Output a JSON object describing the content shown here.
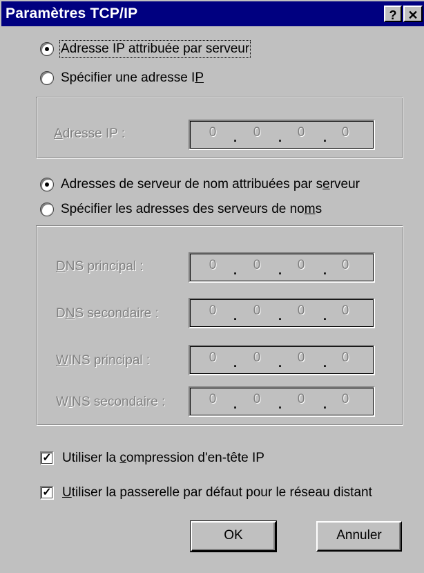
{
  "window": {
    "title": "Paramètres TCP/IP",
    "help_label": "?",
    "close_label": "✕"
  },
  "ip_section": {
    "server_assigned_label": "Adresse IP attribuée par serveur",
    "server_assigned_selected": true,
    "specify_label_pre": "Spécifier une adresse I",
    "specify_label_acc": "P",
    "specify_selected": false,
    "ip_label_acc": "A",
    "ip_label_rest": "dresse IP :",
    "ip_octets": [
      "0",
      "0",
      "0",
      "0"
    ]
  },
  "dns_section": {
    "server_assigned_pre": "Adresses de serveur de nom attribuées par s",
    "server_assigned_acc": "e",
    "server_assigned_post": "rveur",
    "server_assigned_selected": true,
    "specify_pre": "Spécifier les adresses des serveurs de no",
    "specify_acc": "m",
    "specify_post": "s",
    "specify_selected": false,
    "fields": [
      {
        "acc": "D",
        "rest": "NS principal :",
        "octets": [
          "0",
          "0",
          "0",
          "0"
        ]
      },
      {
        "pre": "D",
        "acc": "N",
        "rest": "S secondaire :",
        "octets": [
          "0",
          "0",
          "0",
          "0"
        ]
      },
      {
        "acc": "W",
        "rest": "INS principal :",
        "octets": [
          "0",
          "0",
          "0",
          "0"
        ]
      },
      {
        "pre": "W",
        "acc": "I",
        "rest": "NS secondaire :",
        "octets": [
          "0",
          "0",
          "0",
          "0"
        ]
      }
    ]
  },
  "options": {
    "compression_pre": "Utiliser la ",
    "compression_acc": "c",
    "compression_post": "ompression d'en-tête IP",
    "compression_checked": true,
    "gateway_acc": "U",
    "gateway_post": "tiliser la passerelle par défaut pour le réseau distant",
    "gateway_checked": true,
    "check_mark": "✓"
  },
  "buttons": {
    "ok": "OK",
    "cancel": "Annuler"
  }
}
